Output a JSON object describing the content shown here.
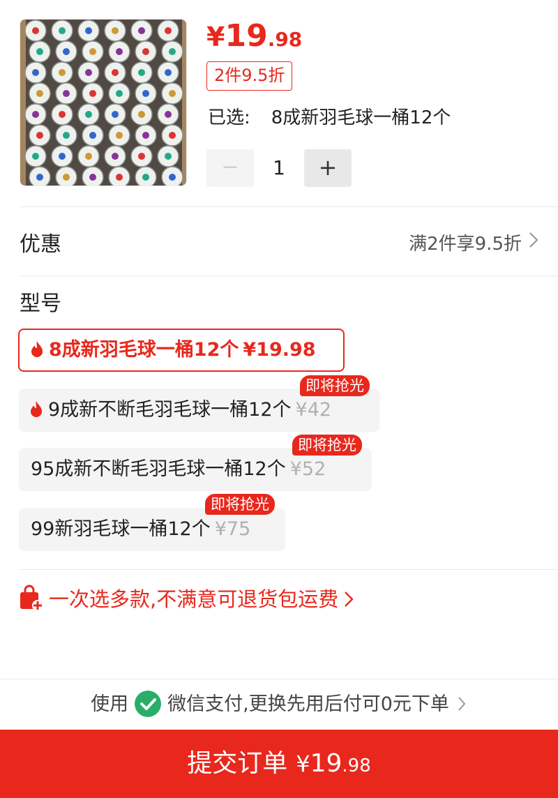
{
  "product": {
    "image_alt": "badminton shuttlecock tubes",
    "price_currency": "¥",
    "price_int": "19",
    "price_dec": ".98",
    "discount_tag": "2件9.5折",
    "selected_label": "已选:",
    "selected_value": "8成新羽毛球一桶12个",
    "quantity": "1",
    "minus_symbol": "−",
    "plus_symbol": "+"
  },
  "promo": {
    "title": "优惠",
    "value": "满2件享9.5折"
  },
  "model": {
    "title": "型号",
    "options": [
      {
        "label": "8成新羽毛球一桶12个",
        "price": "¥19.98",
        "selected": true,
        "hot": true,
        "badge": ""
      },
      {
        "label": "9成新不断毛羽毛球一桶12个",
        "price": "¥42",
        "selected": false,
        "hot": true,
        "badge": "即将抢光"
      },
      {
        "label": "95成新不断毛羽毛球一桶12个",
        "price": "¥52",
        "selected": false,
        "hot": false,
        "badge": "即将抢光"
      },
      {
        "label": "99新羽毛球一桶12个",
        "price": "¥75",
        "selected": false,
        "hot": false,
        "badge": "即将抢光"
      }
    ]
  },
  "guarantee": {
    "text": "一次选多款,不满意可退货包运费"
  },
  "payment": {
    "prefix": "使用",
    "text": "微信支付,更换先用后付可0元下单"
  },
  "submit": {
    "label": "提交订单",
    "currency": "¥",
    "int": "19",
    "dec": ".98"
  },
  "colors": {
    "accent": "#e8281d",
    "wechat_green": "#2aae67"
  }
}
